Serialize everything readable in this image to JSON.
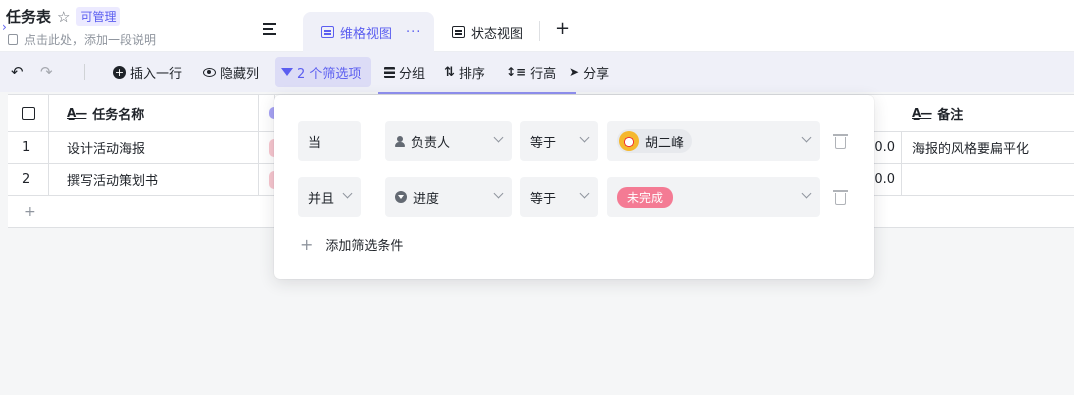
{
  "header": {
    "title": "任务表",
    "permission_badge": "可管理",
    "description_placeholder": "点击此处，添加一段说明"
  },
  "tabs": [
    {
      "label": "维格视图",
      "active": true,
      "more": "···"
    },
    {
      "label": "状态视图",
      "active": false
    }
  ],
  "add_view_label": "+",
  "toolbar": {
    "insert_row": "插入一行",
    "hide_columns": "隐藏列",
    "filter": "2 个筛选项",
    "group": "分组",
    "sort": "排序",
    "row_height": "行高",
    "share": "分享"
  },
  "table": {
    "columns": [
      "任务名称",
      "备注"
    ],
    "rows": [
      {
        "index": "1",
        "name": "设计活动海报",
        "num": "0.0",
        "note": "海报的风格要扁平化"
      },
      {
        "index": "2",
        "name": "撰写活动策划书",
        "num": "0.0",
        "note": ""
      }
    ],
    "add_row_label": "+"
  },
  "filter_popover": {
    "conditions": [
      {
        "conjunction": "当",
        "field": "负责人",
        "operator": "等于",
        "value": "胡二峰"
      },
      {
        "conjunction": "并且",
        "field": "进度",
        "operator": "等于",
        "value": "未完成"
      }
    ],
    "add_condition_label": "添加筛选条件"
  },
  "colors": {
    "accent": "#5b5ef0",
    "toolbar_bg": "#eff0f8",
    "tag_pink": "#f47b94"
  }
}
